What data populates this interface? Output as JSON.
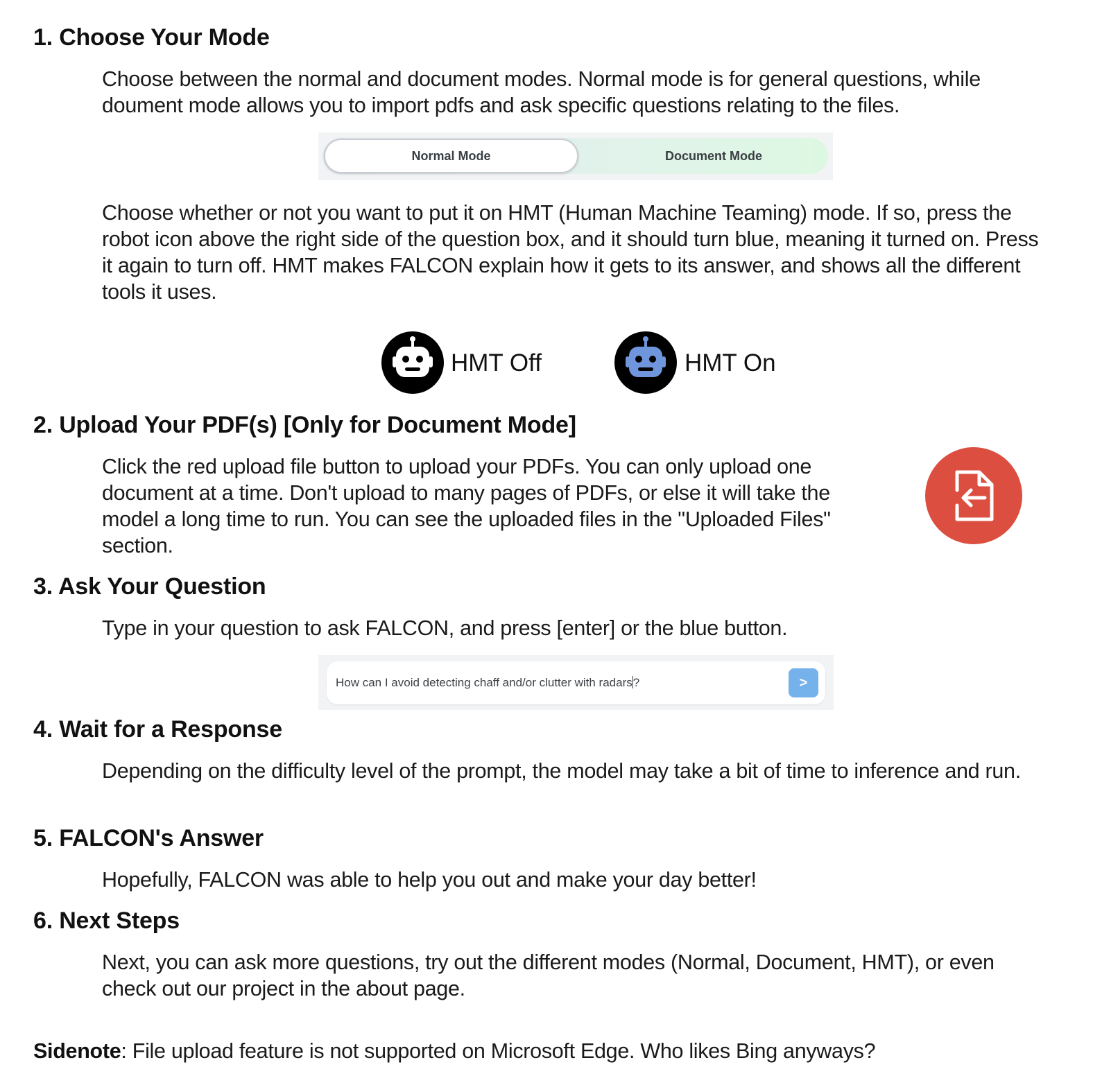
{
  "sections": [
    {
      "heading": "1. Choose Your Mode",
      "paragraphs": [
        "Choose between the normal and document modes. Normal mode is for general questions, while doument mode allows you to import pdfs and ask specific questions relating to the files.",
        "Choose whether or not you want to put it on HMT (Human Machine Teaming) mode. If so, press the robot icon above the right side of the question box, and it should turn blue, meaning it turned on. Press it again to turn off. HMT makes FALCON explain how it gets to its answer, and shows all the different tools it uses."
      ]
    },
    {
      "heading": "2. Upload Your PDF(s) [Only for Document Mode]",
      "paragraphs": [
        "Click the red upload file button to upload your PDFs. You can only upload one document at a time. Don't upload to many pages of PDFs, or else it will take the model a long time to run. You can see the uploaded files in the \"Uploaded Files\" section."
      ]
    },
    {
      "heading": "3. Ask Your Question",
      "paragraphs": [
        "Type in your question to ask FALCON, and press [enter] or the blue button."
      ]
    },
    {
      "heading": "4. Wait for a Response",
      "paragraphs": [
        "Depending on the difficulty level of the prompt, the model may take a bit of time to inference and run."
      ]
    },
    {
      "heading": "5. FALCON's Answer",
      "paragraphs": [
        "Hopefully, FALCON was able to help you out and make your day better!"
      ]
    },
    {
      "heading": "6. Next Steps",
      "paragraphs": [
        "Next, you can ask more questions, try out the different modes (Normal, Document, HMT), or even check out our project in the about page."
      ]
    }
  ],
  "mode_toggle": {
    "normal_label": "Normal Mode",
    "document_label": "Document Mode",
    "selected": "Normal Mode"
  },
  "hmt": {
    "off_label": "HMT Off",
    "on_label": "HMT On",
    "off_color": "#000000",
    "on_color": "#6f96dd"
  },
  "upload": {
    "icon": "file-import-icon",
    "color": "#dc4e3f"
  },
  "question_box": {
    "text_before_caret": "How can I avoid detecting chaff and/or clutter with radars",
    "text_after_caret": "?",
    "send_label": ">",
    "send_color": "#75b1ea"
  },
  "sidenote": {
    "label": "Sidenote",
    "text": ": File upload feature is not supported on Microsoft Edge. Who likes Bing anyways?"
  }
}
